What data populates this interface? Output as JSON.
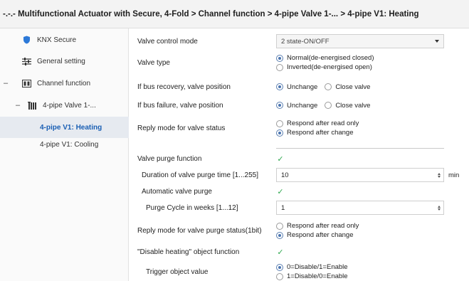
{
  "title": "-.-.- Multifunctional Actuator with Secure, 4-Fold > Channel function > 4-pipe Valve 1-... > 4-pipe V1: Heating",
  "sidebar": {
    "items": [
      {
        "label": "KNX Secure",
        "icon": "shield-icon"
      },
      {
        "label": "General setting",
        "icon": "sliders-icon"
      },
      {
        "label": "Channel function",
        "icon": "channel-icon"
      },
      {
        "label": "4-pipe Valve 1-...",
        "icon": "radiator-icon"
      },
      {
        "label": "4-pipe V1: Heating"
      },
      {
        "label": "4-pipe V1: Cooling"
      }
    ],
    "collapse_symbol": "–"
  },
  "params": {
    "valve_control_mode": {
      "label": "Valve control mode",
      "value": "2 state-ON/OFF"
    },
    "valve_type": {
      "label": "Valve type",
      "options": [
        "Normal(de-energised closed)",
        "Inverted(de-energised open)"
      ],
      "selected": 0
    },
    "bus_recovery": {
      "label": "If bus recovery, valve position",
      "options": [
        "Unchange",
        "Close valve"
      ],
      "selected": 0
    },
    "bus_failure": {
      "label": "If bus failure, valve position",
      "options": [
        "Unchange",
        "Close valve"
      ],
      "selected": 0
    },
    "reply_mode_status": {
      "label": "Reply mode for valve status",
      "options": [
        "Respond after read only",
        "Respond after change"
      ],
      "selected": 1
    },
    "purge_function": {
      "label": "Valve purge function",
      "checked": true
    },
    "purge_duration": {
      "label": "Duration of valve purge time [1...255]",
      "value": "10",
      "unit": "min"
    },
    "auto_purge": {
      "label": "Automatic valve purge",
      "checked": true
    },
    "purge_cycle": {
      "label": "Purge Cycle in weeks [1...12]",
      "value": "1"
    },
    "reply_mode_purge": {
      "label": "Reply mode for valve purge status(1bit)",
      "options": [
        "Respond after read only",
        "Respond after change"
      ],
      "selected": 1
    },
    "disable_heating": {
      "label": "\"Disable heating\" object function",
      "checked": true
    },
    "trigger_value": {
      "label": "Trigger object value",
      "options": [
        "0=Disable/1=Enable",
        "1=Disable/0=Enable"
      ],
      "selected": 0
    }
  },
  "colors": {
    "accent": "#1a5fb4",
    "check": "#2fa84f",
    "radio_selected": "#4a74b0",
    "active_bg": "#e6eaf0"
  }
}
